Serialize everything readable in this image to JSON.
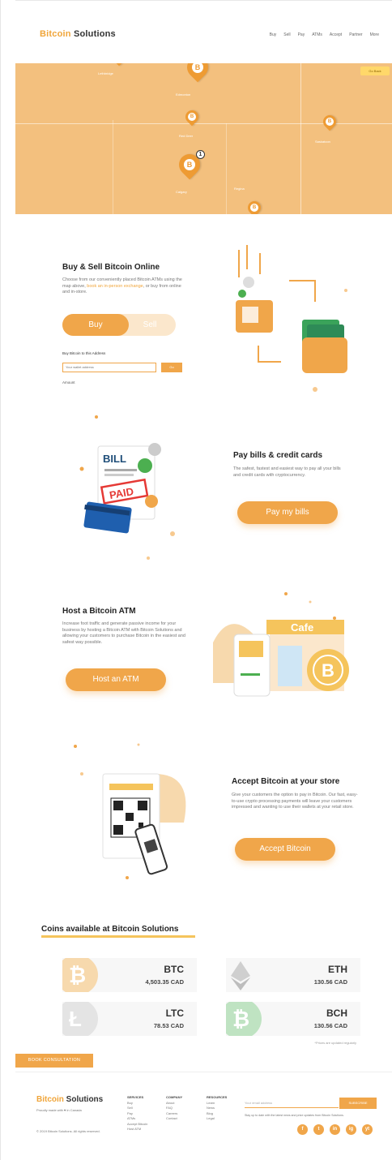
{
  "header": {
    "logo_prefix": "Bitcoin",
    "logo_suffix": " Solutions",
    "nav": [
      "Buy",
      "Sell",
      "Pay",
      "ATMs",
      "Accept",
      "Partner",
      "More"
    ]
  },
  "map": {
    "tag": "Go Back",
    "cities": [
      "Edmonton",
      "Calgary",
      "Red Deer",
      "Saskatoon",
      "Regina",
      "Lethbridge"
    ]
  },
  "buy_sell": {
    "title": "Buy & Sell Bitcoin Online",
    "text_1": "Choose from our conveniently placed Bitcoin ATMs using the map above, ",
    "text_link": "book an in-person exchange",
    "text_2": ", or buy from online and in-store.",
    "buy_label": "Buy",
    "sell_label": "Sell",
    "form_label": "Buy Bitcoin to this Address",
    "input_placeholder": "Your wallet address",
    "go_label": "Go",
    "amount_label": "Amount"
  },
  "pay_bills": {
    "title": "Pay bills & credit cards",
    "text": "The safest, fastest and easiest way to pay all your bills and credit cards with cryptocurrency.",
    "button": "Pay my bills",
    "bill_word": "BILL",
    "paid_word": "PAID"
  },
  "host_atm": {
    "title": "Host a Bitcoin ATM",
    "text": "Increase foot traffic and generate passive income for your business by hosting a Bitcoin ATM with Bitcoin Solutions and allowing your customers to purchase Bitcoin in the easiest and safest way possible.",
    "button": "Host an ATM",
    "cafe_word": "Cafe"
  },
  "accept": {
    "title": "Accept Bitcoin at your store",
    "text": "Give your customers the option to pay in Bitcoin. Our fast, easy-to-use crypto processing payments will leave your customers impressed and wanting to use their wallets at your retail store.",
    "button": "Accept Bitcoin"
  },
  "coins": {
    "title": "Coins available at Bitcoin Solutions",
    "items": [
      {
        "symbol": "BTC",
        "price": "4,503.35 CAD",
        "color": "#f7d9ad",
        "glyph": "₿"
      },
      {
        "symbol": "ETH",
        "price": "130.56 CAD",
        "color": "#dcdcdc",
        "glyph": "◆"
      },
      {
        "symbol": "LTC",
        "price": "78.53 CAD",
        "color": "#e4e4e4",
        "glyph": "Ł"
      },
      {
        "symbol": "BCH",
        "price": "130.56 CAD",
        "color": "#bfe3c2",
        "glyph": "₿"
      }
    ],
    "note": "*Prices are updated regularly"
  },
  "consult_button": "BOOK CONSULTATION",
  "footer": {
    "logo_prefix": "Bitcoin",
    "logo_suffix": " Solutions",
    "tagline": "Proudly made with ♥ in Canada",
    "copyright": "© 2019 Bitcoin Solutions. All rights reserved.",
    "col1_head": "SERVICES",
    "col1": [
      "Buy",
      "Sell",
      "Pay",
      "ATMs",
      "Accept Bitcoin",
      "Host ATM"
    ],
    "col2_head": "COMPANY",
    "col2": [
      "About",
      "FAQ",
      "Careers",
      "Contact"
    ],
    "col3_head": "RESOURCES",
    "col3": [
      "Learn",
      "News",
      "Blog",
      "Legal"
    ],
    "subscribe_placeholder": "Your email address",
    "subscribe_button": "SUBSCRIBE",
    "subscribe_note": "Stay up to date with the latest news and price updates from Bitcoin Solutions.",
    "social": [
      "f",
      "t",
      "in",
      "ig",
      "yt"
    ]
  }
}
